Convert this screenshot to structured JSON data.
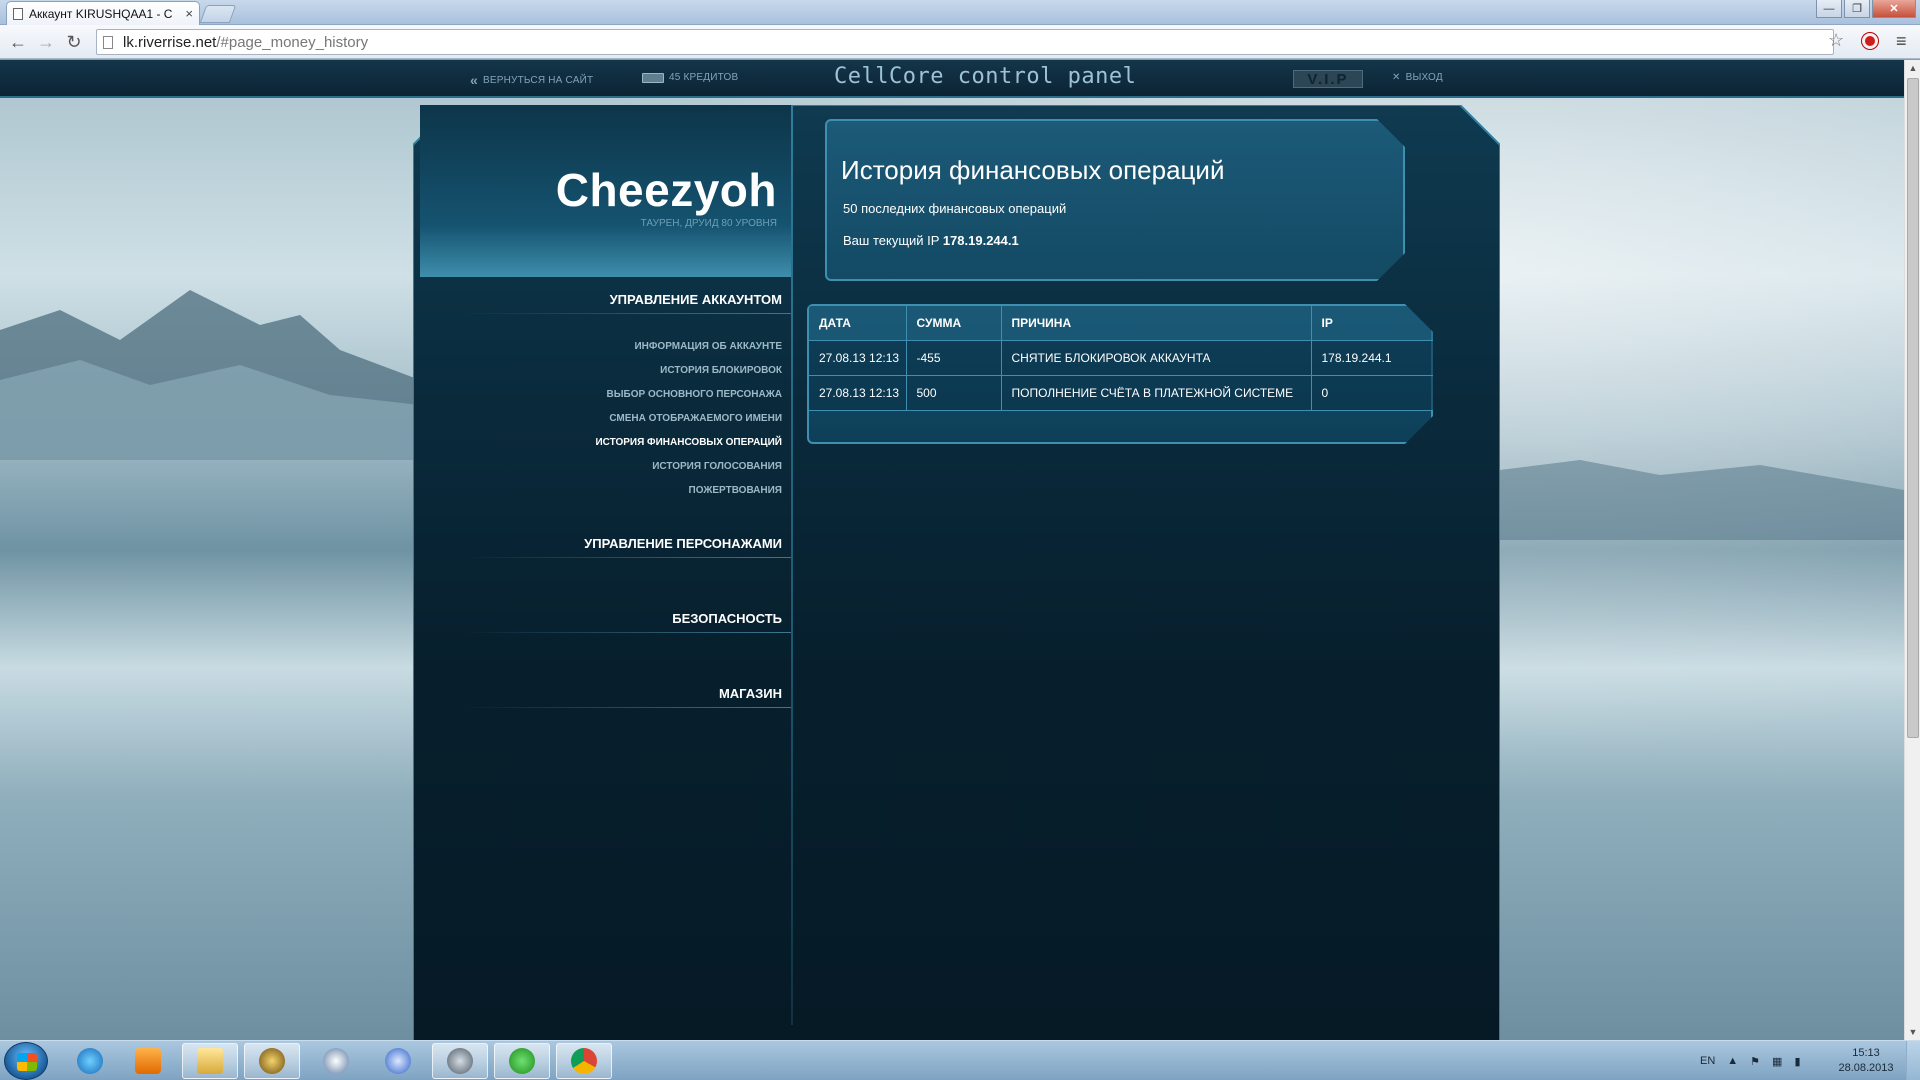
{
  "browser": {
    "tab_title": "Аккаунт KIRUSHQAA1 - C",
    "tab_close": "×",
    "url_host": "lk.riverrise.net",
    "url_path": "/#page_money_history",
    "back": "←",
    "forward": "→",
    "reload": "↻",
    "star": "☆",
    "menu": "≡",
    "win_minimize": "—",
    "win_maximize": "❐",
    "win_close": "✕"
  },
  "sitebar": {
    "back_to_site": "ВЕРНУТЬСЯ НА САЙТ",
    "credits": "45 КРЕДИТОВ",
    "brand": "CellCore control panel",
    "vip": "V.I.P",
    "logout": "ВЫХОД",
    "back_arrows": "«",
    "logout_x": "✕"
  },
  "character": {
    "name": "Cheezyoh",
    "subtitle": "ТАУРЕН, ДРУИД 80 УРОВНЯ"
  },
  "sidebar": {
    "account_section": "УПРАВЛЕНИЕ АККАУНТОМ",
    "items": [
      {
        "label": "ИНФОРМАЦИЯ ОБ АККАУНТЕ"
      },
      {
        "label": "ИСТОРИЯ БЛОКИРОВОК"
      },
      {
        "label": "ВЫБОР ОСНОВНОГО ПЕРСОНАЖА"
      },
      {
        "label": "СМЕНА ОТОБРАЖАЕМОГО ИМЕНИ"
      },
      {
        "label": "ИСТОРИЯ ФИНАНСОВЫХ ОПЕРАЦИЙ"
      },
      {
        "label": "ИСТОРИЯ ГОЛОСОВАНИЯ"
      },
      {
        "label": "ПОЖЕРТВОВАНИЯ"
      }
    ],
    "active_item": "ИСТОРИЯ ФИНАНСОВЫХ ОПЕРАЦИЙ",
    "characters_section": "УПРАВЛЕНИЕ ПЕРСОНАЖАМИ",
    "security_section": "БЕЗОПАСНОСТЬ",
    "shop_section": "МАГАЗИН"
  },
  "info": {
    "title": "История финансовых операций",
    "subtitle": "50 последних финансовых операций",
    "ip_label": "Ваш текущий IP",
    "ip_value": "178.19.244.1"
  },
  "table": {
    "headers": [
      "ДАТА",
      "СУММА",
      "ПРИЧИНА",
      "IP"
    ],
    "rows": [
      [
        "27.08.13 12:13",
        "-455",
        "СНЯТИЕ БЛОКИРОВОК АККАУНТА",
        "178.19.244.1"
      ],
      [
        "27.08.13 12:13",
        "500",
        "ПОПОЛНЕНИЕ СЧЁТА В ПЛАТЕЖНОЙ СИСТЕМЕ",
        "0"
      ]
    ]
  },
  "taskbar": {
    "language": "EN",
    "time": "15:13",
    "date": "28.08.2013",
    "tray_arrow": "▲"
  },
  "colors": {
    "accent": "#3e8fb0",
    "panel_dark": "#071f2d",
    "text_light": "#ffffff",
    "muted": "#9cb9c7"
  }
}
